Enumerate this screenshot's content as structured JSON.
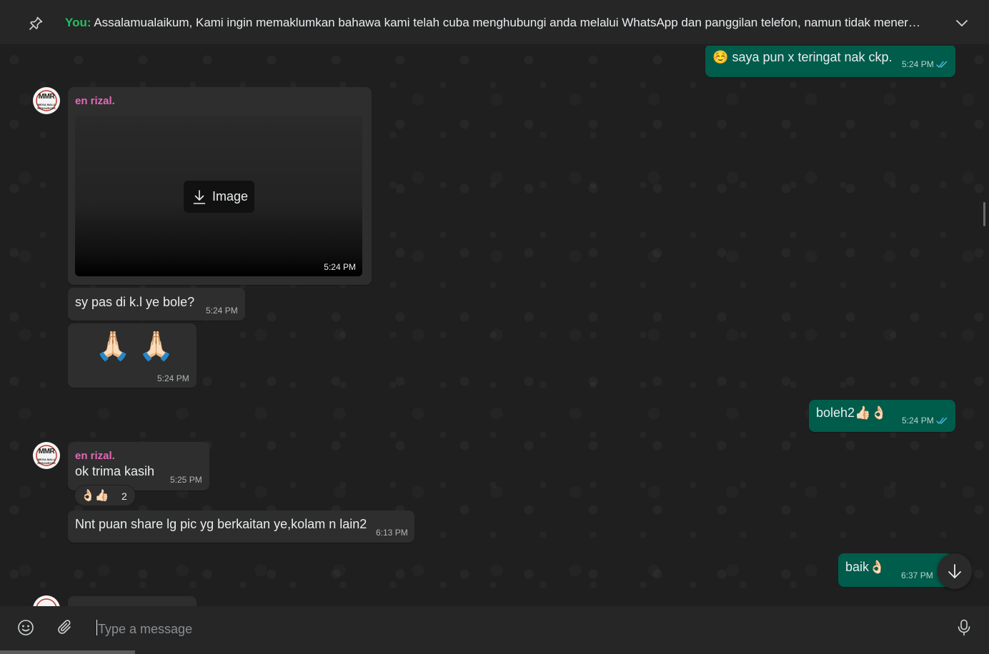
{
  "pinned": {
    "sender": "You:",
    "text": "Assalamualaikum,  Kami ingin memaklumkan bahawa kami telah cuba menghubungi anda melalui WhatsApp dan panggilan telefon, namun tidak mener…"
  },
  "messages": {
    "m1": {
      "emoji": "☺️",
      "text": "saya pun x teringat nak ckp.",
      "time": "5:24 PM"
    },
    "m2": {
      "sender": "en rizal.",
      "image_label": "Image",
      "time": "5:24 PM"
    },
    "m3": {
      "text": "sy pas di k.l ye bole?",
      "time": "5:24 PM"
    },
    "m4": {
      "emoji": "🙏🏻 🙏🏻",
      "time": "5:24 PM"
    },
    "m5": {
      "text": "boleh2👍🏻👌🏻",
      "time": "5:24 PM"
    },
    "m6": {
      "sender": "en rizal.",
      "text": "ok trima kasih",
      "time": "5:25 PM"
    },
    "m6_reaction": {
      "emojis": "👌🏻👍🏻",
      "count": "2"
    },
    "m7": {
      "text": "Nnt puan share lg pic yg berkaitan ye,kolam n lain2",
      "time": "6:13 PM"
    },
    "m8": {
      "text": "baik👌🏻",
      "time": "6:37 PM"
    }
  },
  "avatar": {
    "logo": "MMR",
    "subtitle": "MEGA MALU RESOURCES"
  },
  "composer": {
    "placeholder": "Type a message"
  },
  "colors": {
    "incoming_bubble": "#2e2e2e",
    "outgoing_bubble": "#005c4b",
    "sender_name": "#e26ab6",
    "pinned_sender": "#21c063",
    "read_ticks": "#53bdeb"
  },
  "icons": {
    "pin": "pin-icon",
    "chevron": "chevron-down-icon",
    "download": "download-icon",
    "read": "double-check-icon",
    "scroll_down": "arrow-down-icon",
    "emoji": "smiley-icon",
    "attach": "paperclip-icon",
    "mic": "microphone-icon"
  }
}
